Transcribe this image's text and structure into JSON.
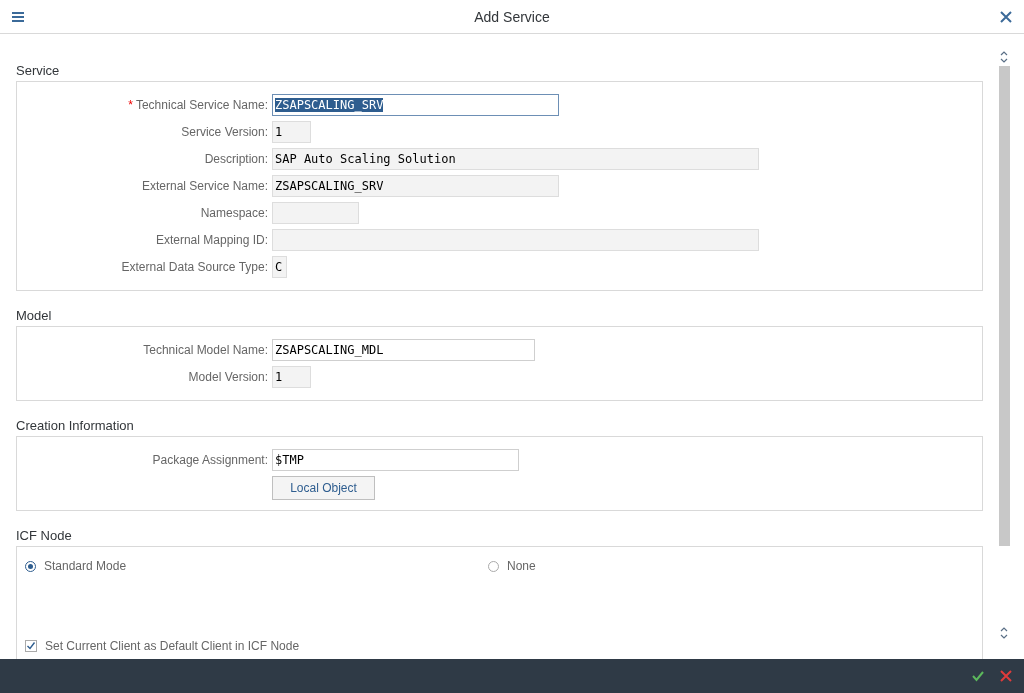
{
  "window": {
    "title": "Add Service"
  },
  "sections": [
    {
      "title": "Service",
      "fields": [
        {
          "required_mark": "*",
          "label": "Technical Service Name:",
          "value": "ZSAPSCALING_SRV",
          "readonly": false,
          "text_selected": true
        },
        {
          "label": "Service Version:",
          "value": "1",
          "readonly": true,
          "text_selected": false
        },
        {
          "label": "Description:",
          "value": "SAP Auto Scaling Solution",
          "readonly": true,
          "text_selected": false
        },
        {
          "label": "External Service Name:",
          "value": "ZSAPSCALING_SRV",
          "readonly": true,
          "text_selected": false
        },
        {
          "label": "Namespace:",
          "readonly": true,
          "text_selected": false
        },
        {
          "label": "External Mapping ID:",
          "readonly": true,
          "text_selected": false
        },
        {
          "label": "External Data Source Type:",
          "value": "C",
          "readonly": true,
          "text_selected": false
        }
      ]
    },
    {
      "title": "Model",
      "fields": [
        {
          "label": "Technical Model Name:",
          "value": "ZSAPSCALING_MDL",
          "readonly": false,
          "text_selected": false
        },
        {
          "label": "Model Version:",
          "value": "1",
          "readonly": true,
          "text_selected": false
        }
      ]
    },
    {
      "title": "Creation Information",
      "fields": [
        {
          "label": "Package Assignment:",
          "value": "$TMP",
          "readonly": false,
          "text_selected": false
        }
      ],
      "button": "Local Object"
    }
  ],
  "icf_node": {
    "title": "ICF Node",
    "radios": [
      {
        "label": "Standard Mode",
        "selected": true
      },
      {
        "label": "None",
        "selected": false
      }
    ],
    "checkbox": {
      "label": "Set Current Client as Default Client in ICF Node",
      "checked": true
    }
  }
}
